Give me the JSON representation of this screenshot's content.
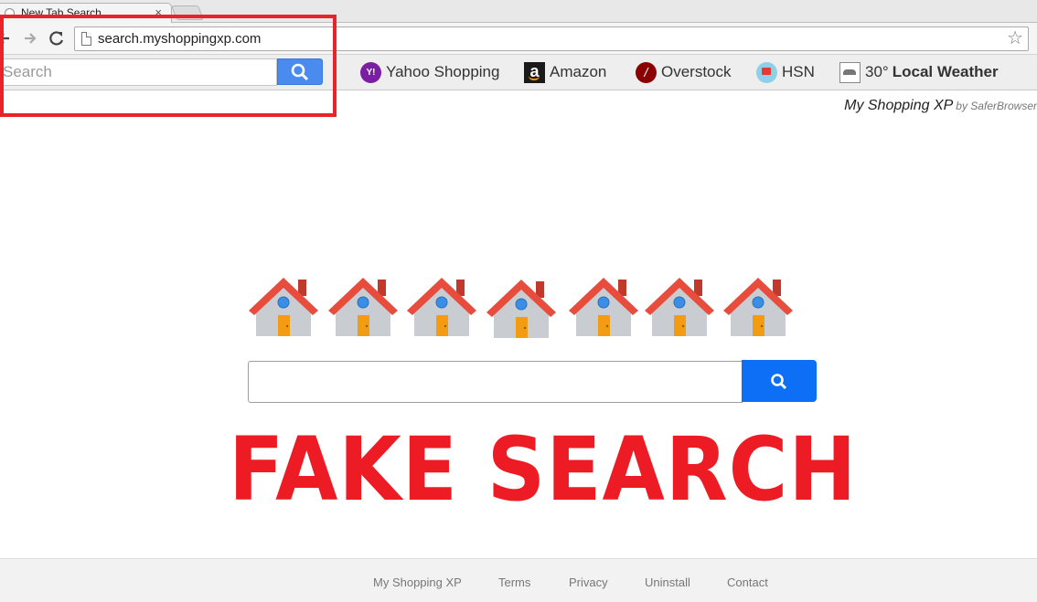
{
  "browser": {
    "tab_title": "New Tab Search",
    "tab_close": "×",
    "url": "search.myshoppingxp.com",
    "star": "☆"
  },
  "toolbar": {
    "search_placeholder": "Search",
    "links": {
      "yahoo": "Yahoo Shopping",
      "yahoo_icon_text": "Y!",
      "amazon": "Amazon",
      "amazon_icon_text": "a",
      "overstock": "Overstock",
      "overstock_icon_text": "/",
      "hsn": "HSN",
      "weather_temp": "30°",
      "weather_label": "Local Weather"
    }
  },
  "brand": {
    "name": "My Shopping XP",
    "by": "by SaferBrowser"
  },
  "main": {
    "search_value": "",
    "house_count": 7,
    "watermark": "FAKE SEARCH"
  },
  "footer": {
    "links": [
      "My Shopping XP",
      "Terms",
      "Privacy",
      "Uninstall",
      "Contact"
    ]
  },
  "colors": {
    "accent_blue": "#0c6ff5",
    "toolbar_button": "#4a8bf0",
    "watermark_red": "#ed1c24",
    "annotation_red": "#e8232a"
  },
  "icons": {
    "back": "arrow-left-icon",
    "forward": "arrow-right-icon",
    "reload": "reload-icon",
    "page": "page-icon",
    "bookmark": "star-icon",
    "search": "magnifier-icon",
    "house": "house-icon"
  }
}
